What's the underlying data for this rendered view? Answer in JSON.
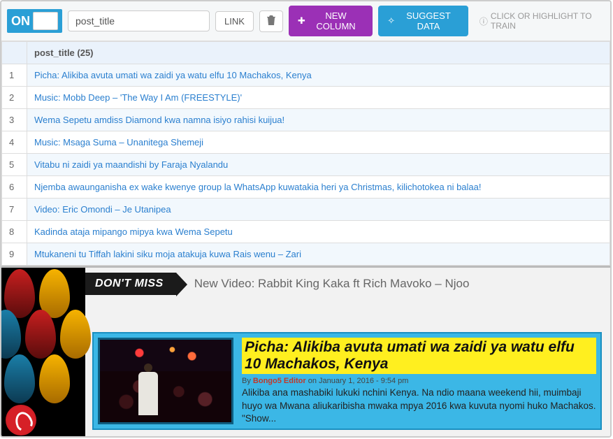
{
  "toolbar": {
    "toggle": "ON",
    "field_value": "post_title",
    "link_btn": "LINK",
    "new_col_btn": "NEW COLUMN",
    "suggest_btn": "SUGGEST DATA",
    "helper": "CLICK OR HIGHLIGHT TO TRAIN"
  },
  "table": {
    "header": "post_title (25)",
    "rows": [
      {
        "n": "1",
        "title": "Picha: Alikiba avuta umati wa zaidi ya watu elfu 10 Machakos, Kenya"
      },
      {
        "n": "2",
        "title": "Music: Mobb Deep – 'The Way I Am (FREESTYLE)'"
      },
      {
        "n": "3",
        "title": "Wema Sepetu amdiss Diamond kwa namna isiyo rahisi kuijua!"
      },
      {
        "n": "4",
        "title": "Music: Msaga Suma – Unanitega Shemeji"
      },
      {
        "n": "5",
        "title": "Vitabu ni zaidi ya maandishi by Faraja Nyalandu"
      },
      {
        "n": "6",
        "title": "Njemba awaunganisha ex wake kwenye group la WhatsApp kuwatakia heri ya Christmas, kilichotokea ni balaa!"
      },
      {
        "n": "7",
        "title": "Video: Eric Omondi – Je Utanipea"
      },
      {
        "n": "8",
        "title": "Kadinda ataja mipango mipya kwa Wema Sepetu"
      },
      {
        "n": "9",
        "title": "Mtukaneni tu Tiffah lakini siku moja atakuja kuwa Rais wenu – Zari"
      }
    ]
  },
  "preview": {
    "dont_miss_label": "DON'T MISS",
    "dont_miss_text": "New Video: Rabbit King Kaka ft Rich Mavoko – Njoo",
    "article": {
      "title": "Picha: Alikiba avuta umati wa zaidi ya watu elfu 10 Machakos, Kenya",
      "by_prefix": "By ",
      "author": "Bongo5 Editor",
      "on": " on ",
      "date": "January 1, 2016 - 9:54 pm",
      "excerpt": "Alikiba ana mashabiki lukuki nchini Kenya. Na ndio maana weekend hii, muimbaji huyo wa Mwana aliukaribisha mwaka mpya 2016 kwa kuvuta nyomi huko Machakos. \"Show..."
    }
  }
}
